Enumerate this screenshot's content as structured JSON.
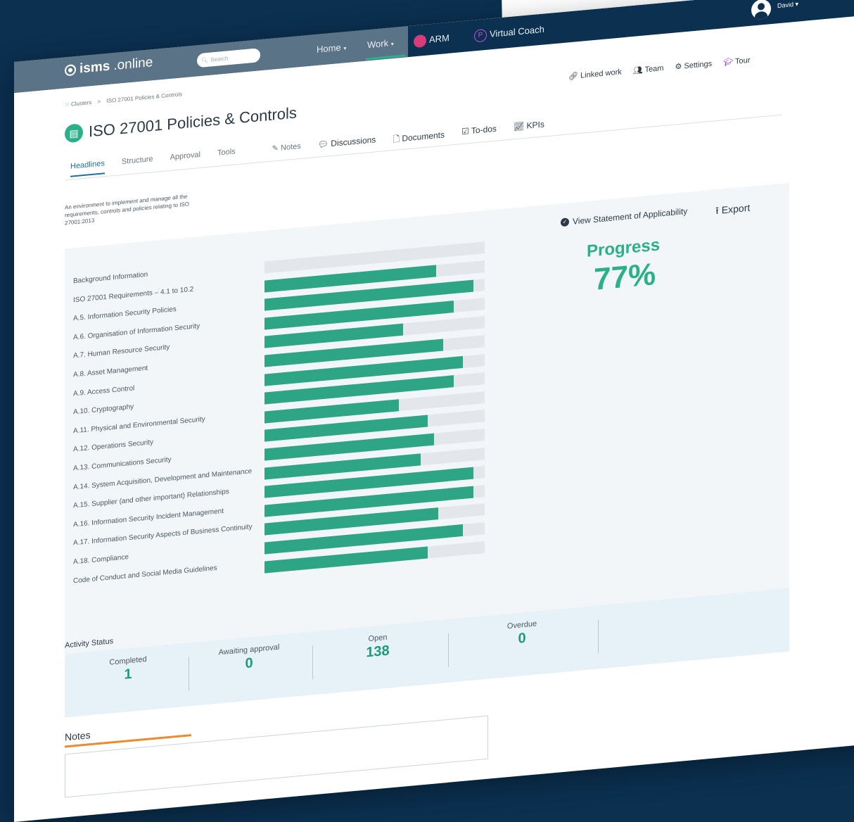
{
  "topbar": {
    "logo_bold": "isms",
    "logo_rest": ".online",
    "search_placeholder": "Search",
    "nav": {
      "home": "Home",
      "work": "Work",
      "arm": "ARM",
      "virtual_coach": "Virtual Coach"
    },
    "user_name": "David"
  },
  "breadcrumb": {
    "root": "Clusters",
    "separator": ">",
    "current": "ISO 27001 Policies & Controls"
  },
  "page": {
    "title": "ISO 27001 Policies & Controls",
    "description": "An environment to implement and manage all the requirements, controls and policies relating to ISO 27001:2013"
  },
  "header_actions": {
    "linked_work": "Linked work",
    "team": "Team",
    "settings": "Settings",
    "tour": "Tour"
  },
  "tabs": {
    "headlines": "Headlines",
    "structure": "Structure",
    "approval": "Approval",
    "tools": "Tools",
    "notes": "Notes",
    "discussions": "Discussions",
    "documents": "Documents",
    "todos": "To-dos",
    "kpis": "KPIs"
  },
  "progress": {
    "soa_label": "View Statement of Applicability",
    "export_label": "Export",
    "label": "Progress",
    "value": "77%"
  },
  "chart_data": {
    "type": "bar",
    "categories": [
      "Background Information",
      "ISO 27001 Requirements – 4.1 to 10.2",
      "A.5. Information Security Policies",
      "A.6. Organisation of Information Security",
      "A.7. Human Resource Security",
      "A.8. Asset Management",
      "A.9. Access Control",
      "A.10. Cryptography",
      "A.11. Physical and Environmental Security",
      "A.12. Operations Security",
      "A.13. Communications Security",
      "A.14. System Acquisition, Development and Maintenance",
      "A.15. Supplier (and other important) Relationships",
      "A.16. Information Security Incident Management",
      "A.17. Information Security Aspects of Business Continuity",
      "A.18. Compliance",
      "Code of Conduct and Social Media Guidelines"
    ],
    "values": [
      0,
      78,
      95,
      86,
      63,
      81,
      90,
      86,
      61,
      74,
      77,
      71,
      95,
      95,
      79,
      90,
      74
    ],
    "ylim": [
      0,
      100
    ]
  },
  "activity": {
    "title": "Activity Status",
    "stats": [
      {
        "label": "Completed",
        "value": "1"
      },
      {
        "label": "Awaiting approval",
        "value": "0"
      },
      {
        "label": "Open",
        "value": "138"
      },
      {
        "label": "Overdue",
        "value": "0"
      }
    ]
  },
  "notes": {
    "title": "Notes"
  },
  "colors": {
    "navy": "#0b3050",
    "accent_green": "#2bb089",
    "bar_fill": "#2ea584",
    "bar_track": "#e3e6ea",
    "notes_accent": "#ef8a2a",
    "tour_purple": "#8c2bbf"
  }
}
